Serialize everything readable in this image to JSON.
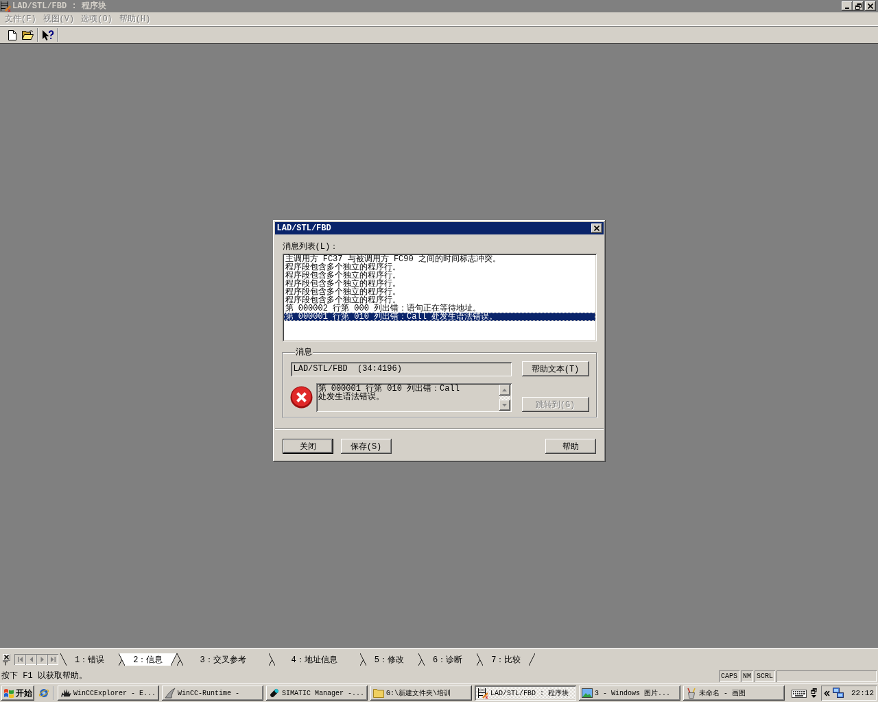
{
  "window": {
    "title": "LAD/STL/FBD : 程序块"
  },
  "menu": [
    {
      "label": "文件(F)",
      "disabled": true
    },
    {
      "label": "视图(V)",
      "disabled": true
    },
    {
      "label": "选项(O)",
      "disabled": true
    },
    {
      "label": "帮助(H)",
      "disabled": true
    }
  ],
  "dialog": {
    "title": "LAD/STL/FBD",
    "list_label": "消息列表(L)：",
    "messages": [
      {
        "text": "主调用方 FC37 与被调用方 FC90 之间的时间标志冲突。",
        "selected": false
      },
      {
        "text": "程序段包含多个独立的程序行。",
        "selected": false
      },
      {
        "text": "程序段包含多个独立的程序行。",
        "selected": false
      },
      {
        "text": "程序段包含多个独立的程序行。",
        "selected": false
      },
      {
        "text": "程序段包含多个独立的程序行。",
        "selected": false
      },
      {
        "text": "程序段包含多个独立的程序行。",
        "selected": false
      },
      {
        "text": "第 000002 行第 000 列出错：语句正在等待地址。",
        "selected": false
      },
      {
        "text": "第 000001 行第 010 列出错：Call 处发生语法错误。",
        "selected": true
      }
    ],
    "group_label": "消息",
    "source": "LAD/STL/FBD  (34:4196)",
    "detail_lines": [
      "第 000001 行第 010 列出错：Call",
      "处发生语法错误。"
    ],
    "side_buttons": [
      {
        "label": "帮助文本(T)",
        "disabled": false
      },
      {
        "label": "跳转到(G)",
        "disabled": true
      }
    ],
    "buttons": [
      {
        "label": "关闭",
        "default": true
      },
      {
        "label": "保存(S)",
        "default": false
      }
    ],
    "help_button": {
      "label": "帮助",
      "default": false
    }
  },
  "output_tabs": [
    {
      "label": "1：错误",
      "selected": false
    },
    {
      "label": "2：信息",
      "selected": true
    },
    {
      "label": "3：交叉参考",
      "selected": false
    },
    {
      "label": "4：地址信息",
      "selected": false
    },
    {
      "label": "5：修改",
      "selected": false
    },
    {
      "label": "6：诊断",
      "selected": false
    },
    {
      "label": "7：比较",
      "selected": false
    }
  ],
  "status_bar": {
    "text": "按下 F1 以获取帮助。",
    "indicators": [
      "CAPS",
      "NM",
      "SCRL"
    ]
  },
  "taskbar": {
    "start": "开始",
    "tasks": [
      {
        "label": "WinCCExplorer - E...",
        "kind": "explorer",
        "selected": false
      },
      {
        "label": "WinCC-Runtime -",
        "kind": "runtime",
        "selected": false
      },
      {
        "label": "SIMATIC Manager -...",
        "kind": "manager",
        "selected": false
      },
      {
        "label": "G:\\新建文件夹\\培训",
        "kind": "folder",
        "selected": false
      },
      {
        "label": "LAD/STL/FBD : 程序块",
        "kind": "ladder",
        "selected": true
      },
      {
        "label": "3 - Windows 图片...",
        "kind": "picture",
        "selected": false
      },
      {
        "label": "未命名 - 画图",
        "kind": "paint",
        "selected": false
      }
    ],
    "clock": "22:12"
  }
}
